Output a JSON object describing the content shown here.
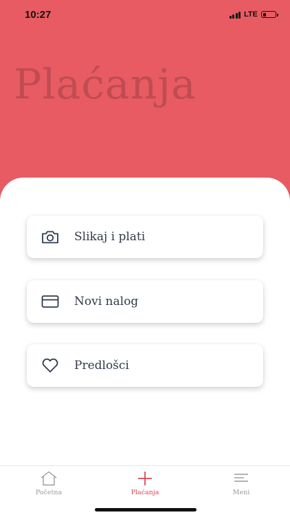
{
  "status_bar": {
    "time": "10:27",
    "network": "LTE",
    "battery_level": 0.3
  },
  "header": {
    "title": "Plaćanja",
    "background_color": "#e85b62"
  },
  "actions": [
    {
      "label": "Slikaj i plati",
      "icon": "camera-icon"
    },
    {
      "label": "Novi nalog",
      "icon": "credit-card-icon"
    },
    {
      "label": "Predlošci",
      "icon": "heart-icon"
    }
  ],
  "tab_bar": {
    "tabs": [
      {
        "label": "Početna",
        "icon": "home-icon",
        "active": false
      },
      {
        "label": "Plaćanja",
        "icon": "plus-icon",
        "active": true
      },
      {
        "label": "Meni",
        "icon": "menu-icon",
        "active": false
      }
    ],
    "accent_color": "#d94650"
  }
}
